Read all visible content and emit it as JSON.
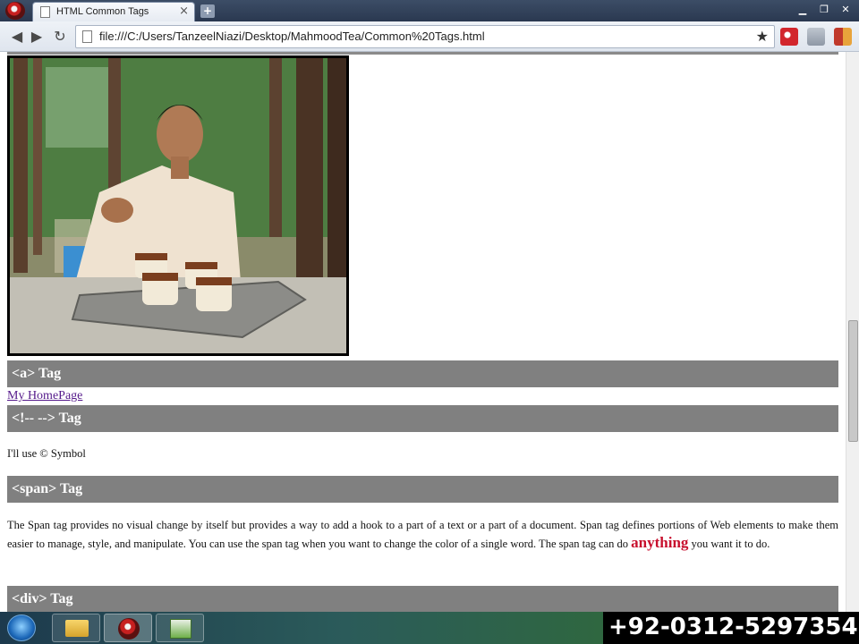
{
  "browser": {
    "tab_title": "HTML Common Tags",
    "tab_close": "×",
    "new_tab": "+",
    "url": "file:///C:/Users/TanzeelNiazi/Desktop/MahmoodTea/Common%20Tags.html",
    "window_controls": {
      "minimize": "▁",
      "restore": "❐",
      "close": "✕"
    },
    "nav": {
      "back": "◀",
      "forward": "▶",
      "reload": "↻"
    }
  },
  "page": {
    "sections": [
      {
        "heading": "<a> Tag"
      },
      {
        "heading": "<!-- --> Tag"
      },
      {
        "heading": "<span> Tag"
      },
      {
        "heading": "<div> Tag"
      }
    ],
    "homepage_link": "My HomePage",
    "symbol_text": "I'll use © Symbol",
    "span_paragraph": {
      "before": "The Span tag provides no visual change by itself but provides a way to add a hook to a part of a text or a part of a document. Span tag defines portions of Web elements to make them easier to manage, style, and manipulate. You can use the span tag when you want to change the color of a single word. The span tag can do ",
      "highlight": "anything",
      "after": " you want it to do."
    }
  },
  "taskbar": {
    "phone_overlay": "+92-0312-5297354"
  },
  "colors": {
    "section_header_bg": "#808080",
    "highlight_word": "#c8102e",
    "visited_link": "#551a8b"
  },
  "icons": [
    "app-menu-icon",
    "page-icon",
    "back-icon",
    "forward-icon",
    "reload-icon",
    "star-icon",
    "search-extension-icon",
    "share-extension-icon",
    "media-extension-icon",
    "windows-start-icon"
  ]
}
